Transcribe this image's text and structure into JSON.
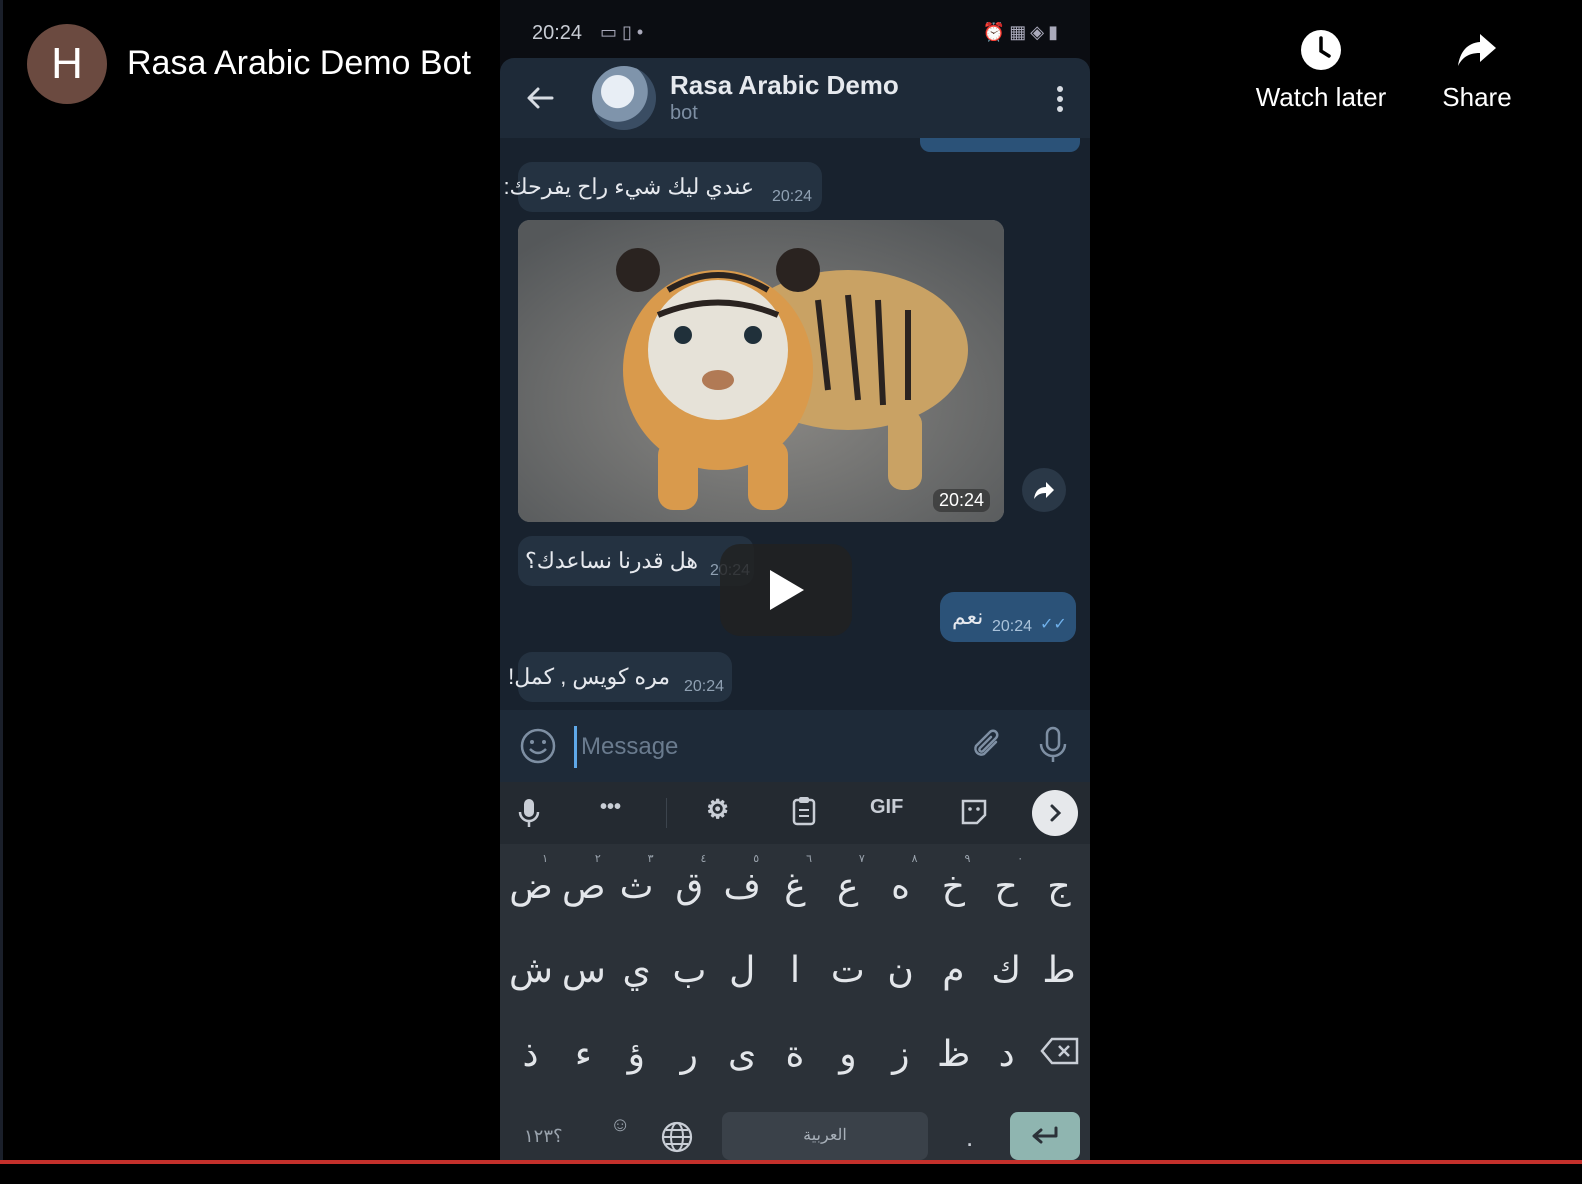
{
  "video": {
    "channel_initial": "H",
    "title": "Rasa Arabic Demo Bot",
    "watch_later_label": "Watch later",
    "share_label": "Share"
  },
  "status_bar": {
    "time": "20:24"
  },
  "chat_header": {
    "title": "Rasa Arabic Demo",
    "subtitle": "bot"
  },
  "messages": [
    {
      "text": "عندي ليك شيء راح يفرحك:",
      "time": "20:24"
    },
    {
      "photo_time": "20:24"
    },
    {
      "text": "هل قدرنا نساعدك؟",
      "time": "20:24"
    },
    {
      "text": "نعم",
      "time": "20:24"
    },
    {
      "text": "مره كويس , كمل!",
      "time": "20:24"
    }
  ],
  "input": {
    "placeholder": "Message"
  },
  "keyboard_toolbar": {
    "gif_label": "GIF"
  },
  "keyboard": {
    "row1": [
      "ض",
      "ص",
      "ث",
      "ق",
      "ف",
      "غ",
      "ع",
      "ه",
      "خ",
      "ح",
      "ج"
    ],
    "row1_hints": [
      "١",
      "٢",
      "٣",
      "٤",
      "٥",
      "٦",
      "٧",
      "٨",
      "٩",
      "٠",
      ""
    ],
    "row2": [
      "ش",
      "س",
      "ي",
      "ب",
      "ل",
      "ا",
      "ت",
      "ن",
      "م",
      "ك",
      "ط"
    ],
    "row3": [
      "ذ",
      "ء",
      "ؤ",
      "ر",
      "ى",
      "ة",
      "و",
      "ز",
      "ظ",
      "د"
    ],
    "numbers_label": "؟١٢٣",
    "space_label": "العربية",
    "period_label": "."
  },
  "colors": {
    "progress": "#c4302b",
    "outgoing_bubble": "#2b5278",
    "incoming_bubble": "#243241"
  }
}
